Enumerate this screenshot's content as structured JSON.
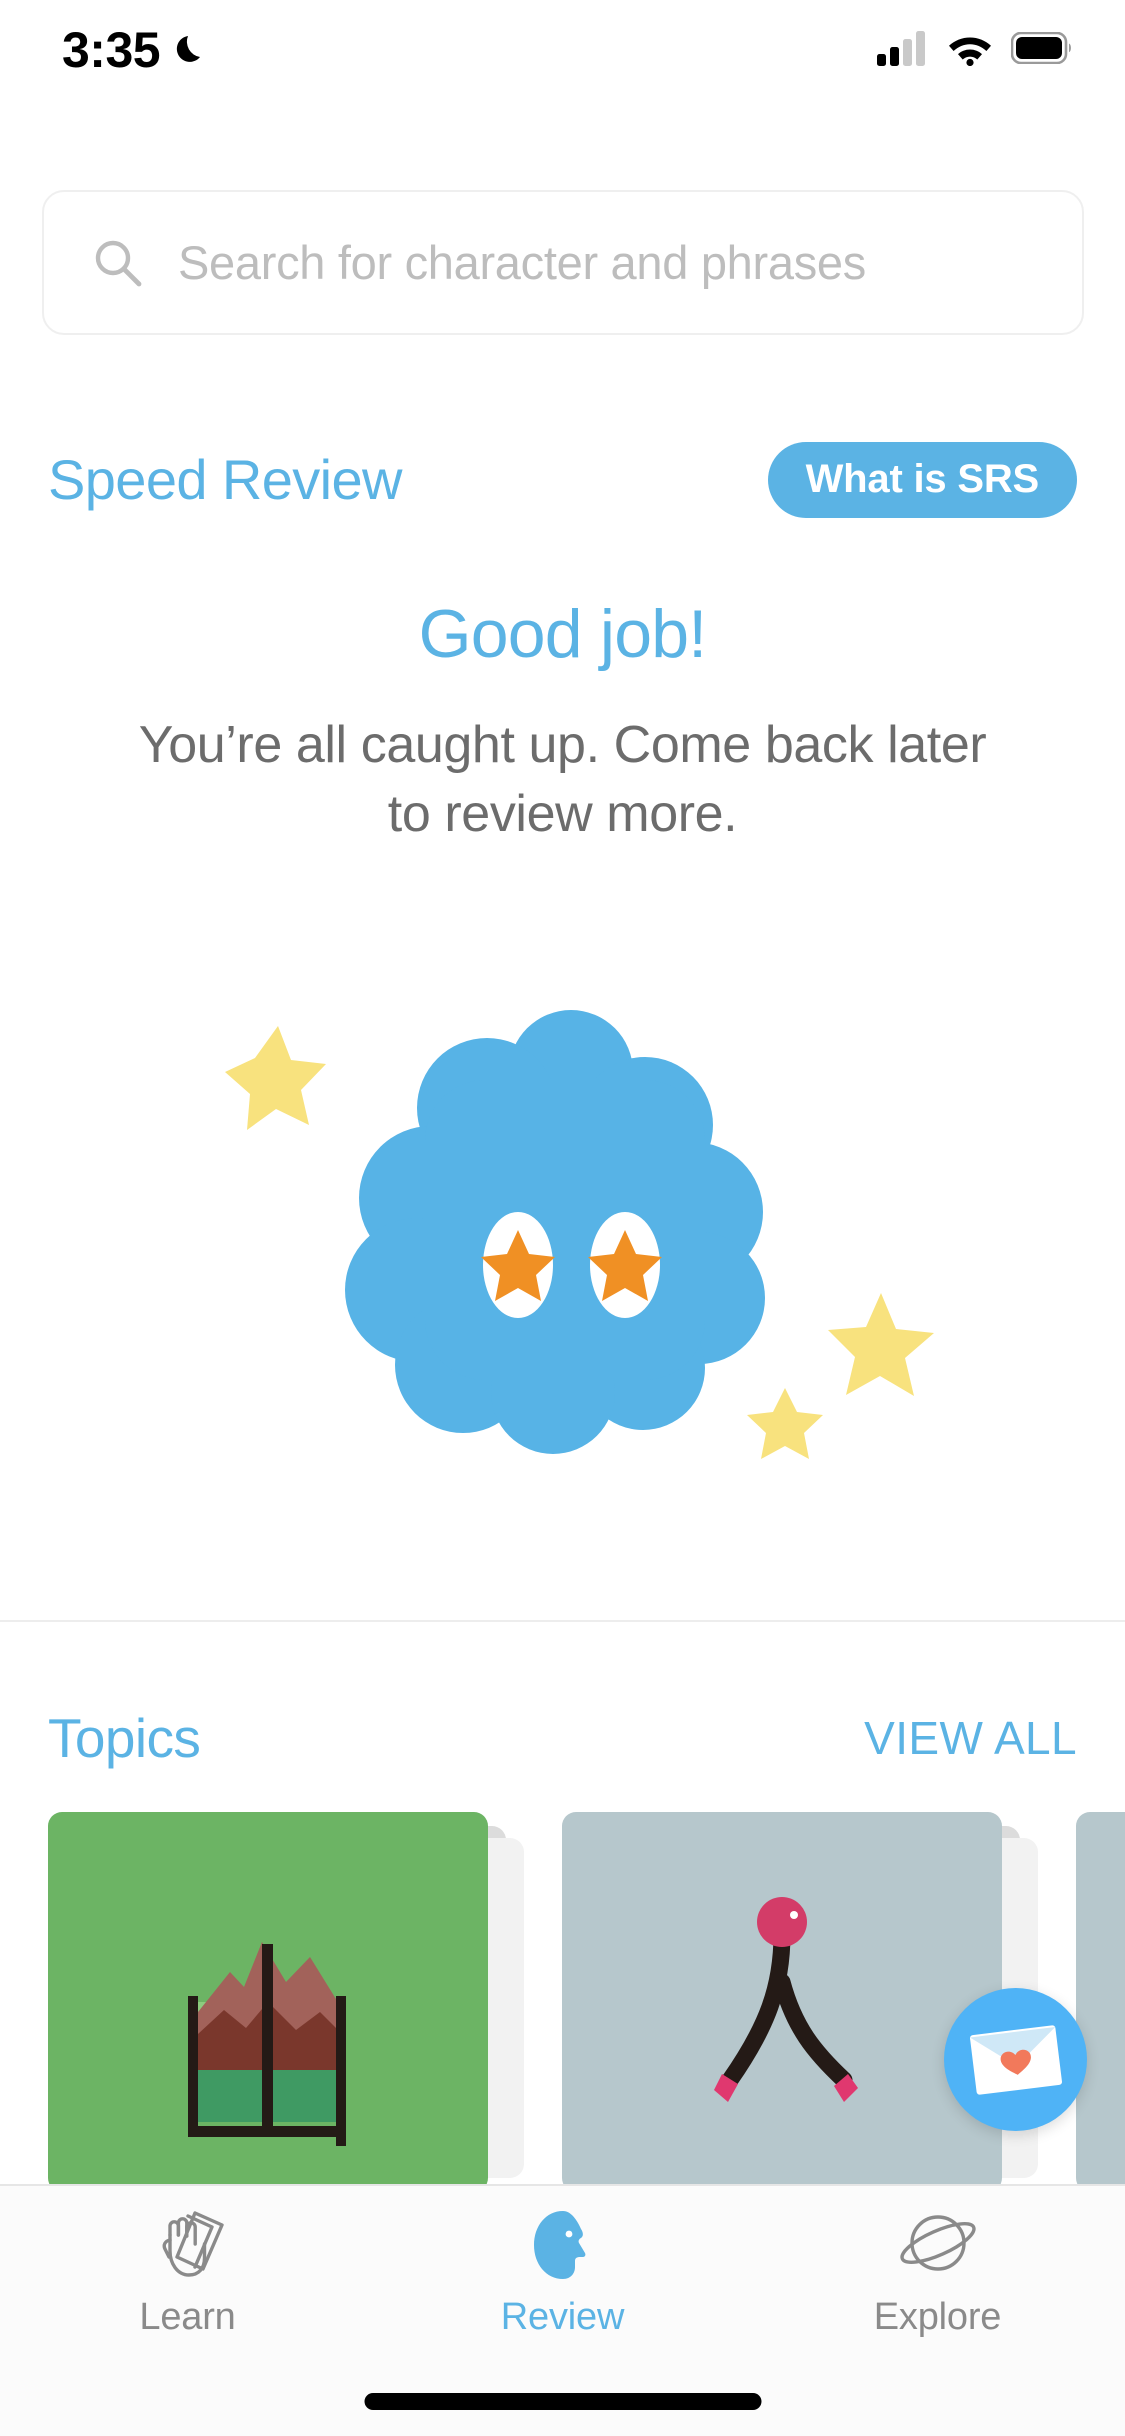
{
  "status_bar": {
    "time": "3:35",
    "dnd_icon": "crescent-moon-icon",
    "signal_icon": "cellular-signal-icon",
    "wifi_icon": "wifi-icon",
    "battery_icon": "battery-full-icon"
  },
  "search": {
    "placeholder": "Search for character and phrases",
    "value": "",
    "icon": "search-icon"
  },
  "speed_review": {
    "title": "Speed Review",
    "srs_button_label": "What is SRS",
    "heading": "Good job!",
    "message": "You’re all caught up. Come back later to review more.",
    "mascot": "blue-cloud-mascot-with-star-eyes"
  },
  "topics": {
    "title": "Topics",
    "view_all_label": "VIEW ALL",
    "cards": [
      {
        "name": "topic-card-mountain-window",
        "art": "mountain-window-icon",
        "bg": "#6CB464"
      },
      {
        "name": "topic-card-person",
        "art": "person-character-icon",
        "bg": "#B6C7CC"
      },
      {
        "name": "topic-card-third",
        "art": "partial-card",
        "bg": "#B6C7CC"
      }
    ],
    "badge": {
      "name": "envelope-heart-badge",
      "icon": "envelope-heart-icon",
      "bg": "#4FB3F6"
    }
  },
  "tab_bar": {
    "tabs": [
      {
        "label": "Learn",
        "icon": "hand-cards-icon",
        "active": false
      },
      {
        "label": "Review",
        "icon": "head-profile-icon",
        "active": true
      },
      {
        "label": "Explore",
        "icon": "planet-icon",
        "active": false
      }
    ]
  },
  "colors": {
    "accent_blue": "#5BB3E4",
    "badge_blue": "#4FB3F6",
    "text_gray": "#6c6c6c",
    "placeholder_gray": "#bdbdbd",
    "card_green": "#6CB464",
    "card_bluegray": "#B6C7CC",
    "star_yellow": "#F8E27E",
    "star_orange": "#F09024"
  }
}
